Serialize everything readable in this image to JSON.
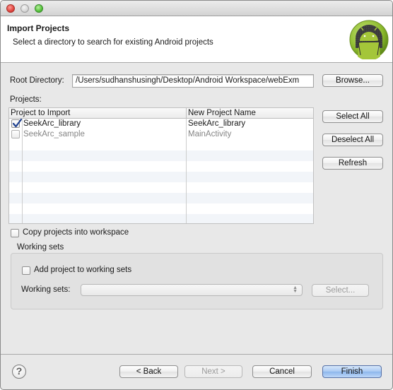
{
  "window": {
    "controls": [
      "close",
      "minimize",
      "maximize"
    ]
  },
  "header": {
    "title": "Import Projects",
    "description": "Select a directory to search for existing Android projects",
    "logo_icon": "android-logo-icon"
  },
  "root_directory": {
    "label": "Root Directory:",
    "value": "/Users/sudhanshusingh/Desktop/Android Workspace/webExm",
    "browse_label": "Browse..."
  },
  "projects": {
    "label": "Projects:",
    "columns": [
      "Project to Import",
      "New Project Name"
    ],
    "rows": [
      {
        "project": "SeekArc_library",
        "new_name": "SeekArc_library",
        "checked": true,
        "enabled": true
      },
      {
        "project": "SeekArc_sample",
        "new_name": "MainActivity",
        "checked": false,
        "enabled": false
      }
    ],
    "select_all_label": "Select All",
    "deselect_all_label": "Deselect All",
    "refresh_label": "Refresh"
  },
  "copy_into_workspace": {
    "label": "Copy projects into workspace",
    "checked": false
  },
  "working_sets": {
    "group_label": "Working sets",
    "add_label": "Add project to working sets",
    "add_checked": false,
    "combo_label": "Working sets:",
    "combo_value": "",
    "select_label": "Select..."
  },
  "footer": {
    "help_glyph": "?",
    "back_label": "< Back",
    "next_label": "Next >",
    "cancel_label": "Cancel",
    "finish_label": "Finish"
  },
  "colors": {
    "default_button": "#a9c9f2",
    "android_green": "#a4c639"
  }
}
